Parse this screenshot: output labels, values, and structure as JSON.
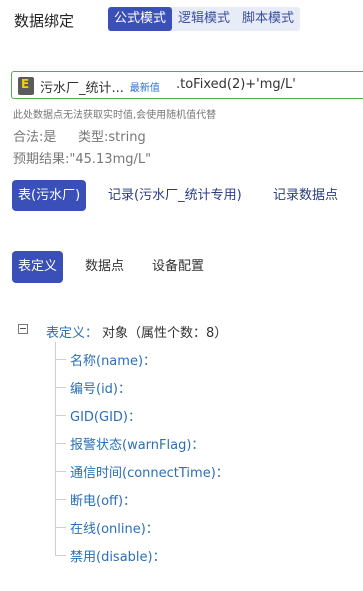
{
  "header": {
    "title": "数据绑定",
    "modes": [
      "公式模式",
      "逻辑模式",
      "脚本模式"
    ],
    "active_mode": "公式模式"
  },
  "expression": {
    "chip_text": "污水厂_统计...",
    "chip_badge": "最新值",
    "suffix": ".toFixed(2)+'mg/L'"
  },
  "warning": "此处数据点无法获取实时值,会使用随机值代替",
  "validity_label": "合法:是",
  "type_label": "类型:string",
  "expected_result": "预期结果:\"45.13mg/L\"",
  "tabs_primary": [
    "表(污水厂)",
    "记录(污水厂_统计专用)",
    "记录数据点"
  ],
  "tabs_secondary": [
    "表定义",
    "数据点",
    "设备配置"
  ],
  "tree": {
    "root_key": "表定义：",
    "root_value": "对象（属性个数：8）",
    "fields": [
      "名称(name)：",
      "编号(id)：",
      "GID(GID)：",
      "报警状态(warnFlag)：",
      "通信时间(connectTime)：",
      "断电(off)：",
      "在线(online)：",
      "禁用(disable)："
    ]
  }
}
